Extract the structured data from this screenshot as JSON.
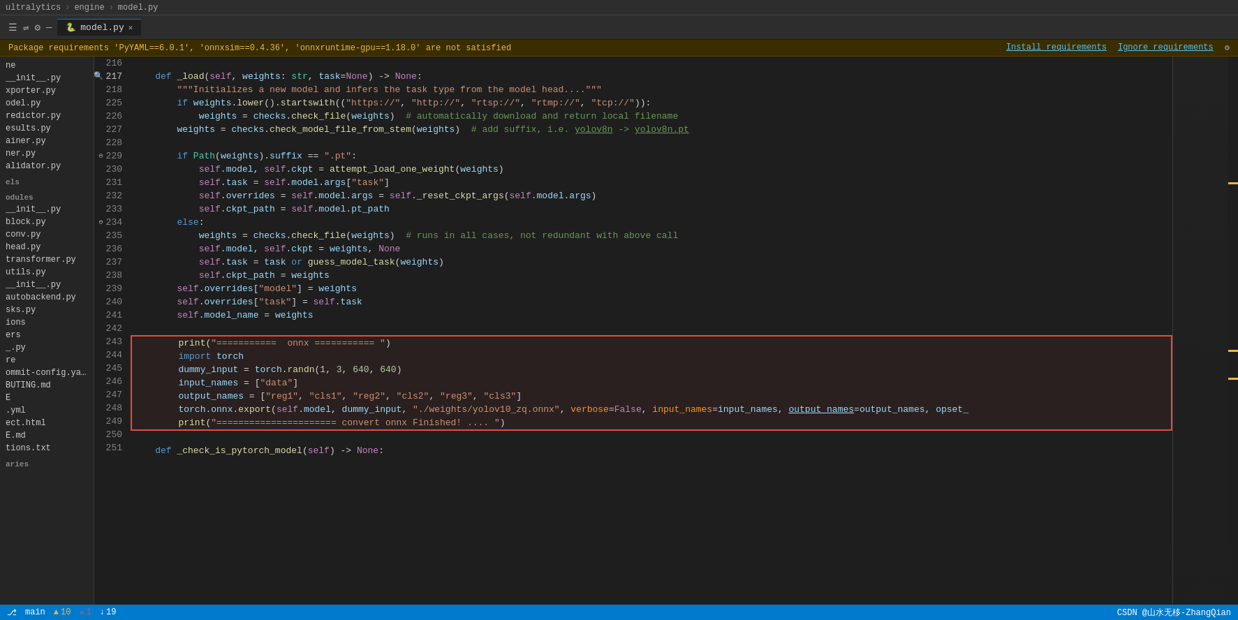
{
  "window": {
    "title": "model.py"
  },
  "breadcrumbs": [
    "ultralytics",
    "engine",
    "model.py"
  ],
  "tab": {
    "label": "model.py",
    "icon": "🐍"
  },
  "warning": {
    "text": "Package requirements 'PyYAML==6.0.1', 'onnxsim==0.4.36', 'onnxruntime-gpu==1.18.0' are not satisfied",
    "install_label": "Install requirements",
    "ignore_label": "Ignore requirements"
  },
  "sidebar": {
    "sections": [
      {
        "name": "",
        "items": [
          "ne",
          "__init__.py",
          "xporter.py",
          "odel.py",
          "redictor.py",
          "esults.py",
          "ainer.py",
          "ner.py",
          "alidator.py"
        ]
      },
      {
        "name": "els",
        "items": []
      },
      {
        "name": "odules",
        "items": [
          "__init__.py",
          "block.py",
          "conv.py",
          "head.py",
          "transformer.py",
          "utils.py",
          "__init__.py",
          "autobackend.py",
          "sks.py",
          "ions",
          "ers"
        ]
      },
      {
        "name": "",
        "items": [
          "_.py",
          "re",
          "ommit-config.yaml",
          "BUTING.md",
          "E",
          ".yml",
          "ect.html",
          "E.md",
          "tions.txt"
        ]
      },
      {
        "name": "aries",
        "items": []
      }
    ]
  },
  "code": {
    "lines": [
      {
        "num": 216,
        "text": "",
        "indent": 0
      },
      {
        "num": 217,
        "text": "    def _load(self, weights: str, task=None) -> None:",
        "indent": 4,
        "has_indicator": true
      },
      {
        "num": 218,
        "text": "        \"\"\"Initializes a new model and infers the task type from the model head....\"\"\"",
        "indent": 8
      },
      {
        "num": 225,
        "text": "        if weights.lower().startswith((\"https://\", \"http://\", \"rtsp://\", \"rtmp://\", \"tcp://\")):",
        "indent": 8
      },
      {
        "num": 226,
        "text": "            weights = checks.check_file(weights)  # automatically download and return local filename",
        "indent": 12
      },
      {
        "num": 227,
        "text": "        weights = checks.check_model_file_from_stem(weights)  # add suffix, i.e. yolov8n -> yolov8n.pt",
        "indent": 8
      },
      {
        "num": 228,
        "text": "",
        "indent": 0
      },
      {
        "num": 229,
        "text": "        if Path(weights).suffix == \".pt\":",
        "indent": 8,
        "has_fold": true
      },
      {
        "num": 230,
        "text": "            self.model, self.ckpt = attempt_load_one_weight(weights)",
        "indent": 12
      },
      {
        "num": 231,
        "text": "            self.task = self.model.args[\"task\"]",
        "indent": 12
      },
      {
        "num": 232,
        "text": "            self.overrides = self.model.args = self._reset_ckpt_args(self.model.args)",
        "indent": 12
      },
      {
        "num": 233,
        "text": "            self.ckpt_path = self.model.pt_path",
        "indent": 12
      },
      {
        "num": 234,
        "text": "        else:",
        "indent": 8,
        "has_fold": true
      },
      {
        "num": 235,
        "text": "            weights = checks.check_file(weights)  # runs in all cases, not redundant with above call",
        "indent": 12
      },
      {
        "num": 236,
        "text": "            self.model, self.ckpt = weights, None",
        "indent": 12
      },
      {
        "num": 237,
        "text": "            self.task = task or guess_model_task(weights)",
        "indent": 12
      },
      {
        "num": 238,
        "text": "            self.ckpt_path = weights",
        "indent": 12
      },
      {
        "num": 239,
        "text": "        self.overrides[\"model\"] = weights",
        "indent": 8
      },
      {
        "num": 240,
        "text": "        self.overrides[\"task\"] = self.task",
        "indent": 8
      },
      {
        "num": 241,
        "text": "        self.model_name = weights",
        "indent": 8
      },
      {
        "num": 242,
        "text": "",
        "indent": 0
      },
      {
        "num": 243,
        "text": "        print(\"===========  onnx =========== \")",
        "indent": 8,
        "highlighted": true
      },
      {
        "num": 244,
        "text": "        import torch",
        "indent": 8,
        "highlighted": true
      },
      {
        "num": 245,
        "text": "        dummy_input = torch.randn(1, 3, 640, 640)",
        "indent": 8,
        "highlighted": true
      },
      {
        "num": 246,
        "text": "        input_names = [\"data\"]",
        "indent": 8,
        "highlighted": true
      },
      {
        "num": 247,
        "text": "        output_names = [\"reg1\", \"cls1\", \"reg2\", \"cls2\", \"reg3\", \"cls3\"]",
        "indent": 8,
        "highlighted": true
      },
      {
        "num": 248,
        "text": "        torch.onnx.export(self.model, dummy_input, \"./weights/yolov10_zq.onnx\", verbose=False, input_names=input_names, output_names=output_names, opset_",
        "indent": 8,
        "highlighted": true
      },
      {
        "num": 249,
        "text": "        print(\"====================== convert onnx Finished! .... \")",
        "indent": 8,
        "highlighted": true
      },
      {
        "num": 250,
        "text": "",
        "indent": 0
      },
      {
        "num": 251,
        "text": "    def _check_is_pytorch_model(self) -> None:",
        "indent": 4
      }
    ]
  },
  "status_bar": {
    "warnings": "▲ 10",
    "errors": "✕ 1",
    "info": "↓ 19",
    "right_items": [
      "CSDN @山水无移-ZhangQian"
    ]
  }
}
